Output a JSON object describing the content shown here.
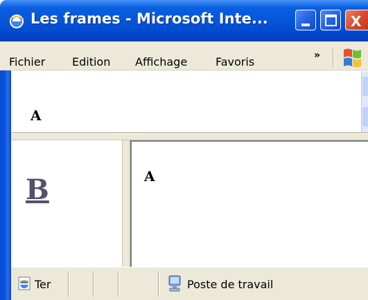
{
  "window": {
    "title": "Les frames - Microsoft Inte...",
    "icon": "ie-icon",
    "controls": {
      "minimize": "minimize-icon",
      "maximize": "maximize-icon",
      "close": "close-icon",
      "close_glyph": "X"
    }
  },
  "menu": {
    "items": [
      "Fichier",
      "Edition",
      "Affichage",
      "Favoris"
    ],
    "overflow": "»",
    "logo": "windows-flag-icon"
  },
  "frames": {
    "top": {
      "text": "A"
    },
    "left": {
      "link": "B"
    },
    "right": {
      "text": "A"
    }
  },
  "status": {
    "text": "Ter",
    "zone": "Poste de travail",
    "zone_icon": "computer-icon"
  },
  "colors": {
    "titlebar": "#0553d8",
    "chrome": "#ece9d8",
    "link": "#55506e",
    "close": "#d8492c"
  }
}
